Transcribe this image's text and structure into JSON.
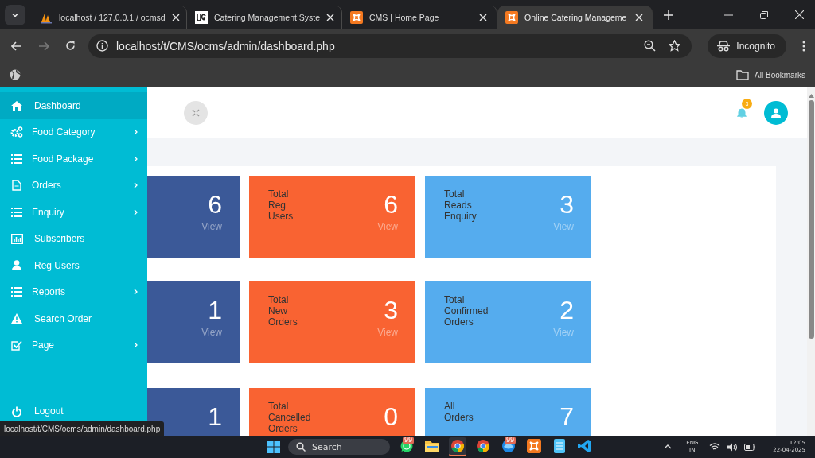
{
  "browser": {
    "tabs": [
      {
        "title": "localhost / 127.0.0.1 / ocmsd",
        "selected": false
      },
      {
        "title": "Catering Management Syste",
        "selected": false
      },
      {
        "title": "CMS | Home Page",
        "selected": false
      },
      {
        "title": "Online Catering Manageme",
        "selected": true
      }
    ],
    "address": "localhost/t/CMS/ocms/admin/dashboard.php",
    "profile": "Incognito",
    "bookmarks_label": "All Bookmarks"
  },
  "sidebar": {
    "items": [
      {
        "label": "Dashboard",
        "submenu": false,
        "selected": true
      },
      {
        "label": "Food Category",
        "submenu": true,
        "selected": false
      },
      {
        "label": "Food Package",
        "submenu": true,
        "selected": false
      },
      {
        "label": "Orders",
        "submenu": true,
        "selected": false
      },
      {
        "label": "Enquiry",
        "submenu": true,
        "selected": false
      },
      {
        "label": "Subscribers",
        "submenu": false,
        "selected": false
      },
      {
        "label": "Reg Users",
        "submenu": false,
        "selected": false
      },
      {
        "label": "Reports",
        "submenu": true,
        "selected": false
      },
      {
        "label": "Search Order",
        "submenu": false,
        "selected": false
      },
      {
        "label": "Page",
        "submenu": true,
        "selected": false
      }
    ],
    "logout": "Logout"
  },
  "header": {
    "notification_count": "3"
  },
  "cards": [
    {
      "count": "6",
      "link": "View",
      "color": "#3b5998"
    },
    {
      "label": "Total Reg Users",
      "count": "6",
      "link": "View",
      "color": "#f96332"
    },
    {
      "label": "Total Reads Enquiry",
      "count": "3",
      "link": "View",
      "color": "#55acee"
    },
    {
      "count": "1",
      "link": "View",
      "color": "#3b5998"
    },
    {
      "label": "Total New Orders",
      "count": "3",
      "link": "View",
      "color": "#f96332"
    },
    {
      "label": "Total Confirmed Orders",
      "count": "2",
      "link": "View",
      "color": "#55acee"
    },
    {
      "count": "1",
      "color": "#3b5998"
    },
    {
      "label": "Total Cancelled Orders",
      "count": "0",
      "color": "#f96332"
    },
    {
      "label": "All Orders",
      "count": "7",
      "color": "#55acee"
    }
  ],
  "status_url": "localhost/t/CMS/ocms/admin/dashboard.php",
  "taskbar": {
    "search": "Search",
    "apps": [
      {
        "badge": "99",
        "selected": false
      },
      {
        "selected": false
      },
      {
        "selected": true
      },
      {
        "selected": false
      },
      {
        "badge": "99",
        "selected": false
      },
      {
        "selected": false
      },
      {
        "selected": false
      },
      {
        "selected": false
      }
    ],
    "language": "ENG",
    "region": "IN",
    "time": "12:05",
    "date": "22-04-2025"
  }
}
